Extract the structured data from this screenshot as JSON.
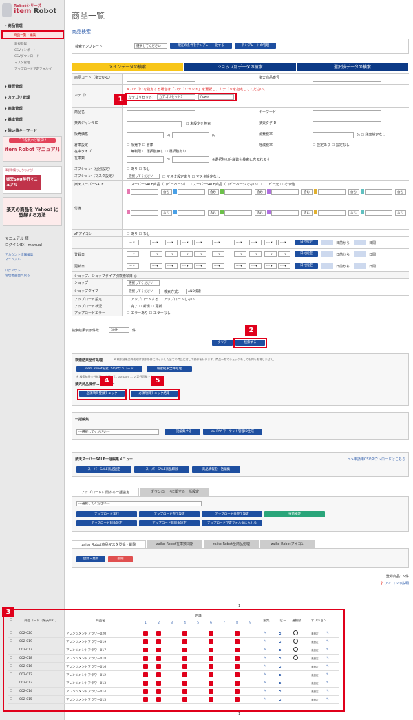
{
  "sidebar": {
    "logo_small": "Robotシリーズ",
    "logo_a": "item ",
    "logo_b": "Robot",
    "sections": [
      {
        "label": "商品管理",
        "items": [
          "商品一覧・編集",
          "新規登録",
          "CSVインポート",
          "CSVダウンロード",
          "マスタ管理",
          "アップロード予定フォルダ"
        ]
      },
      {
        "label": "履歴管理"
      },
      {
        "label": "カテゴリ管理"
      },
      {
        "label": "画像管理"
      },
      {
        "label": "基本管理"
      },
      {
        "label": "除い値キーワード"
      }
    ],
    "banners": [
      "ココを見れば解決!?",
      "item Robot マニュアル",
      "楽天SKU移行マニュアル",
      "楽天の商品を Yahoo! に登録する方法",
      "事前準備もこちらから!"
    ],
    "user_label": "マニュアル 様",
    "login_id": "ログインID：manual",
    "links": [
      "アカウント情報編集",
      "マニュアル",
      "ログアウト",
      "管理者画面へ戻る"
    ]
  },
  "page": {
    "title": "商品一覧",
    "section": "商品検索"
  },
  "template": {
    "label": "検索テンプレート",
    "select": "選択してください",
    "save": "現在の条件をテンプレート化する",
    "manage": "テンプレートの管理"
  },
  "tabs": [
    "メインデータの検索",
    "ショップ別データの検索",
    "選択肢データの検索"
  ],
  "form": {
    "code": "商品コード（楽天URL）",
    "rakuten_no": "楽天商品番号",
    "category": "カテゴリ",
    "cat_note1": "※カテゴリを指定する場合は「カテゴリセット」を選択し、カテゴリを指定してください。",
    "cat_set_label": "カテゴリセット：",
    "cat_set": "カテゴリセット3",
    "cat_value": "flower",
    "name": "商品名",
    "keyword": "キーワード",
    "genre": "楽天ジャンルID",
    "genre_opt": "未設定を検索",
    "tag": "楽天タグID",
    "price": "販売価格",
    "yen": "円",
    "tax": "消費税率",
    "tax_opt": "税率設定なし",
    "stock_set": "倉庫設定",
    "stock_opts": [
      "販売中",
      "倉庫"
    ],
    "light": "軽減税率",
    "light_opts": [
      "設定あり",
      "設定なし"
    ],
    "stock_type": "在庫タイプ",
    "stock_type_opts": [
      "無制限",
      "選択肢無し",
      "選択肢有り"
    ],
    "stock_qty": "在庫数",
    "stock_note": "※選択肢の在庫数も検索に含まれます",
    "opt_item": "オプション（個別設定）",
    "opt_item_v": [
      "あり",
      "なし"
    ],
    "opt_master": "オプション（マスタ設定）",
    "opt_master_v": [
      "マスタ設定あり",
      "マスタ設定なし"
    ],
    "super": "楽天スーパーSALE",
    "super_v": [
      "スーパーSALE商品（コピーページ）",
      "スーパーSALE商品（コピーページでない）",
      "コピー元",
      "その他"
    ],
    "tag2": "付箋",
    "include": "含む",
    "zr": "zRアイコン",
    "zr_v": [
      "あり",
      "なし"
    ],
    "reg": "登録日",
    "upd": "更新日",
    "date_spec": "日付指定",
    "from": "日前から",
    "days": "日間",
    "shop_head": "ショップ、ショップタイプ別検索項目 ◎",
    "shop": "ショップ",
    "shop_type": "ショップタイプ",
    "search_mode": "検索方式：",
    "and": "AND検索",
    "up_set": "アップロード設定",
    "up_set_v": [
      "アップロードする",
      "アップロードしない"
    ],
    "up_state": "アップロード状況",
    "up_state_v": [
      "完了",
      "新規",
      "更新"
    ],
    "up_err": "アップロードエラー",
    "up_err_v": [
      "エラーあり",
      "エラーなし"
    ]
  },
  "result": {
    "label": "検索結果表示件数：",
    "count": "30件",
    "unit": "件",
    "clear": "クリア",
    "search": "検索する"
  },
  "batch": {
    "title": "検索結果全件処理",
    "note": "※ 検索結果全件処理は検索条件にマッチした全ての商品に対して操作を行います。商品一覧でチェックをしても何も影響しません。",
    "csv": "item Robot形式CSVダウンロード",
    "all": "検索結果全件処理",
    "note2": "※ 検索結果全件処理... 楽天、Y... ponpare ... の実行可能です。",
    "check_title": "楽天商品操作... メニュー",
    "check1": "必須項目登録チェック",
    "check2": "必須項目チェック結果"
  },
  "bulk": {
    "title": "一括編集",
    "select": "---選択してください---",
    "edit": "一括編集する",
    "aupay": "au PAY マーケット管理ID生成"
  },
  "sale": {
    "title": "楽天スーパーSALE一括編集メニュー",
    "link": ">>申請用CSVダウンロードはこちら",
    "b1": "スーパーSALE商品設定",
    "b2": "スーパーSALE商品解除",
    "b3": "商品情報を一括編集"
  },
  "upload": {
    "tab1": "アップロードに関する一括設定",
    "tab2": "ダウンロードに関する一括設定",
    "select": "---選択してください---",
    "btns": [
      "アップロード実行",
      "アップロード完了設定",
      "アップロード未完了設定",
      "事前検証",
      "アップロード対象設定",
      "アップロード非対象設定",
      "アップロード予定フォルダに入れる"
    ]
  },
  "zaiko": {
    "tabs": [
      "zaiko Robot商品マスタ登録・削除",
      "zaiko Robot在庫数同期",
      "zaiko Robot全商品処理",
      "zaiko Robotアイコン"
    ],
    "reg": "登録・更新",
    "del": "削除"
  },
  "info": {
    "count": "登録商品：9件",
    "icon_help": "アイコンの説明",
    "page": "1"
  },
  "callouts": [
    "1",
    "2",
    "3",
    "4",
    "5"
  ],
  "table": {
    "headers": {
      "code": "商品コード（楽天URL）",
      "name": "商品名",
      "store": "店舗",
      "edit": "編集",
      "copy": "コピー",
      "choice": "選択肢",
      "option": "オプション"
    },
    "stores": [
      "1",
      "2",
      "3",
      "4",
      "5",
      "6",
      "7",
      "8",
      "9"
    ],
    "unset": "未設定",
    "rows": [
      {
        "code": "002-020",
        "name": "アレンジメントフラワー020",
        "flags": [
          1,
          1,
          0,
          1,
          0,
          1,
          0,
          1,
          0
        ],
        "choice": true
      },
      {
        "code": "002-019",
        "name": "アレンジメントフラワー019",
        "flags": [
          1,
          1,
          0,
          1,
          0,
          1,
          0,
          1,
          0
        ],
        "choice": true
      },
      {
        "code": "002-017",
        "name": "アレンジメントフラワー017",
        "flags": [
          1,
          1,
          0,
          1,
          0,
          1,
          0,
          1,
          0
        ],
        "choice": true
      },
      {
        "code": "002-018",
        "name": "アレンジメントフラワー018",
        "flags": [
          1,
          1,
          0,
          1,
          0,
          1,
          0,
          1,
          0
        ],
        "choice": true
      },
      {
        "code": "002-016",
        "name": "アレンジメントフラワー016",
        "flags": [
          1,
          1,
          0,
          1,
          0,
          1,
          0,
          1,
          0
        ],
        "choice": false
      },
      {
        "code": "002-012",
        "name": "アレンジメントフラワー012",
        "flags": [
          1,
          1,
          0,
          1,
          0,
          1,
          0,
          1,
          0
        ],
        "choice": false
      },
      {
        "code": "002-013",
        "name": "アレンジメントフラワー013",
        "flags": [
          1,
          1,
          0,
          1,
          0,
          1,
          0,
          1,
          0
        ],
        "choice": false
      },
      {
        "code": "002-014",
        "name": "アレンジメントフラワー014",
        "flags": [
          1,
          1,
          0,
          1,
          0,
          1,
          0,
          1,
          0
        ],
        "choice": false
      },
      {
        "code": "002-015",
        "name": "アレンジメントフラワー015",
        "flags": [
          1,
          1,
          0,
          1,
          0,
          1,
          0,
          1,
          0
        ],
        "choice": false
      }
    ]
  }
}
